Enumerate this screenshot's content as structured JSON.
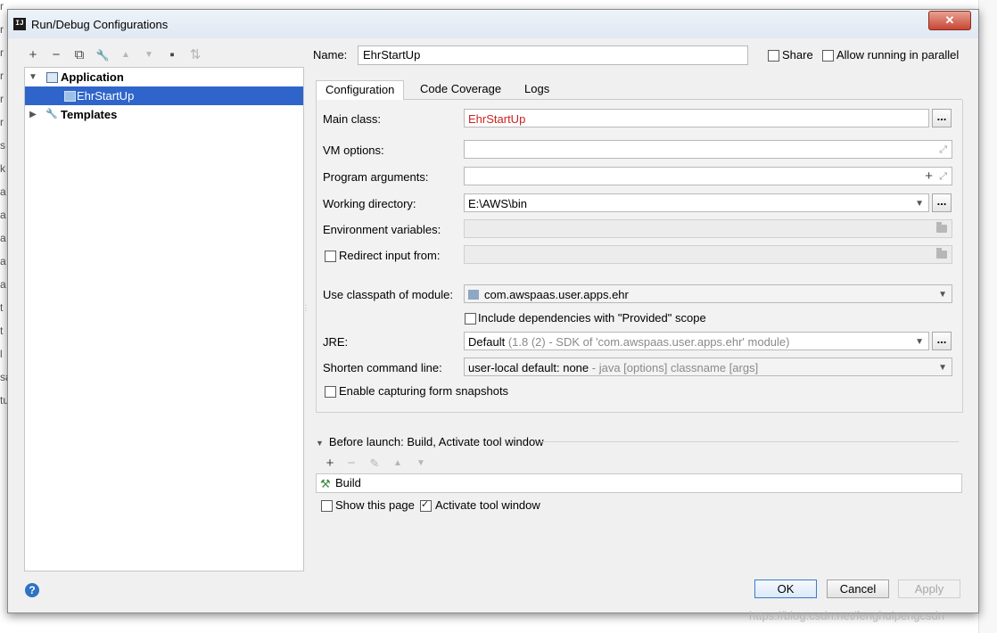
{
  "window": {
    "title": "Run/Debug Configurations",
    "app_icon_text": "IJ",
    "close_glyph": "✕"
  },
  "background_text_fragments": [
    "r",
    "r",
    "r",
    "r",
    "r",
    "r",
    "s",
    "k",
    "a",
    "a",
    "a",
    "a",
    "a",
    "t",
    "t",
    "l",
    "sa",
    "tu"
  ],
  "left_toolbar": {
    "icons": [
      "add-icon",
      "remove-icon",
      "copy-icon",
      "wrench-icon",
      "move-up-icon",
      "move-down-icon",
      "new-folder-icon",
      "sort-icon"
    ],
    "glyphs": {
      "add": "+",
      "remove": "−",
      "copy": "⧉",
      "wrench": "🔧",
      "up": "▲",
      "down": "▼",
      "folder": "▪",
      "sort": "⇅"
    }
  },
  "tree": {
    "items": [
      {
        "label": "Application",
        "expanded": true,
        "icon": "application-icon"
      },
      {
        "label": "EhrStartUp",
        "selected": true,
        "icon": "run-config-icon"
      },
      {
        "label": "Templates",
        "expanded": false,
        "icon": "wrench-icon"
      }
    ]
  },
  "name": {
    "label": "Name:",
    "value": "EhrStartUp"
  },
  "share": {
    "label": "Share",
    "checked": false
  },
  "parallel": {
    "label": "Allow running in parallel",
    "checked": false
  },
  "tabs": [
    {
      "label": "Configuration",
      "active": true
    },
    {
      "label": "Code Coverage",
      "active": false
    },
    {
      "label": "Logs",
      "active": false
    }
  ],
  "config": {
    "main_class": {
      "label": "Main class:",
      "value": "EhrStartUp",
      "color": "#cc2222",
      "btn": "..."
    },
    "vm_options": {
      "label": "VM options:",
      "value": ""
    },
    "program_args": {
      "label": "Program arguments:",
      "value": ""
    },
    "working_dir": {
      "label": "Working directory:",
      "value": "E:\\AWS\\bin",
      "btn": "..."
    },
    "env_vars": {
      "label": "Environment variables:",
      "value": ""
    },
    "redirect": {
      "label": "Redirect input from:",
      "checked": false,
      "value": ""
    },
    "classpath": {
      "label": "Use classpath of module:",
      "value": "com.awspaas.user.apps.ehr"
    },
    "include_deps": {
      "label": "Include dependencies with \"Provided\" scope",
      "checked": false
    },
    "jre": {
      "label": "JRE:",
      "value": "Default",
      "hint": "(1.8 (2) - SDK of 'com.awspaas.user.apps.ehr' module)",
      "btn": "..."
    },
    "shorten": {
      "label": "Shorten command line:",
      "value": "user-local default: none",
      "hint": "- java [options] classname [args]"
    },
    "snapshots": {
      "label": "Enable capturing form snapshots",
      "checked": false
    }
  },
  "before_launch": {
    "header": "Before launch: Build, Activate tool window",
    "toolbar_glyphs": {
      "add": "+",
      "remove": "−",
      "edit": "✎",
      "up": "▲",
      "down": "▼"
    },
    "items": [
      {
        "label": "Build",
        "icon": "build-hammer-icon"
      }
    ],
    "show_page": {
      "label": "Show this page",
      "checked": false
    },
    "activate_tool": {
      "label": "Activate tool window",
      "checked": true
    }
  },
  "footer": {
    "help": "?",
    "ok": "OK",
    "cancel": "Cancel",
    "apply": "Apply"
  },
  "watermark": "https://blog.csdn.net/fenghuipengcsdn"
}
